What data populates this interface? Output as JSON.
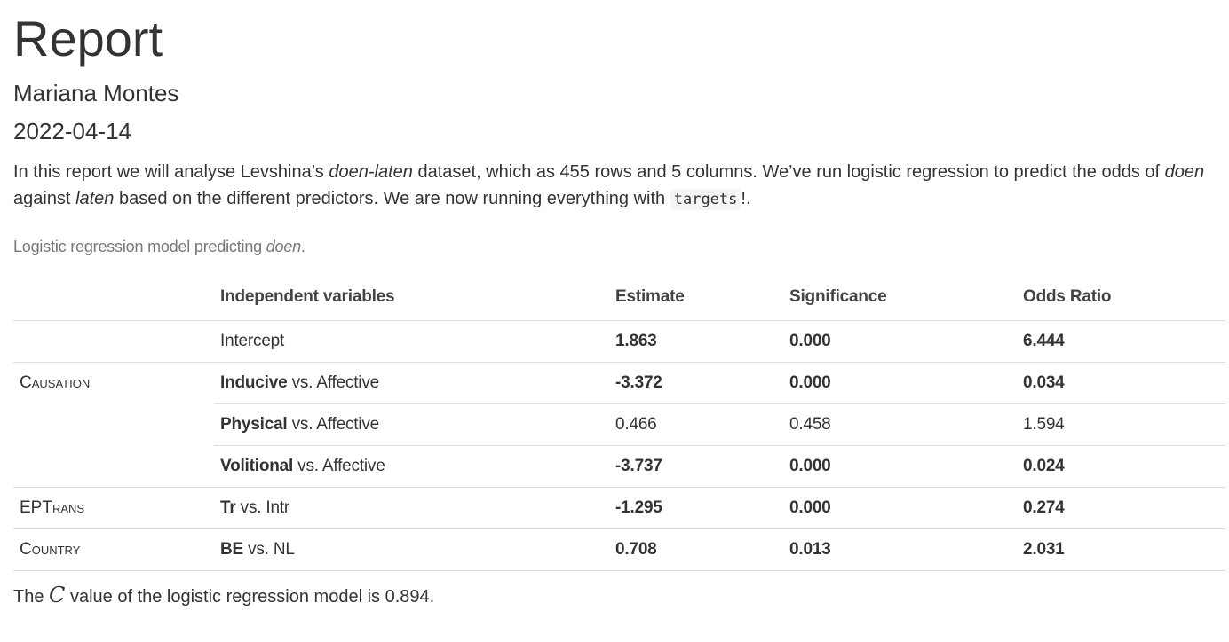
{
  "title": "Report",
  "author": "Mariana Montes",
  "date": "2022-04-14",
  "intro": {
    "p1": "In this report we will analyse Levshina’s ",
    "em1": "doen-laten",
    "p2": " dataset, which as 455 rows and 5 columns. We’ve run logistic regression to predict the odds of ",
    "em2": "doen",
    "p3": " against ",
    "em3": "laten",
    "p4": " based on the different predictors. We are now running everything with ",
    "code": "targets",
    "p5": "!."
  },
  "caption": {
    "text": "Logistic regression model predicting ",
    "em": "doen",
    "end": "."
  },
  "table": {
    "headers": [
      "",
      "Independent variables",
      "Estimate",
      "Significance",
      "Odds Ratio"
    ],
    "rows": [
      {
        "group": "",
        "var_bold": "",
        "var_rest": "Intercept",
        "estimate": "1.863",
        "significance": "0.000",
        "odds": "6.444",
        "bold_values": true
      },
      {
        "group": "Causation",
        "var_bold": "Inducive",
        "var_rest": " vs. Affective",
        "estimate": "-3.372",
        "significance": "0.000",
        "odds": "0.034",
        "bold_values": true
      },
      {
        "group": "",
        "var_bold": "Physical",
        "var_rest": " vs. Affective",
        "estimate": "0.466",
        "significance": "0.458",
        "odds": "1.594",
        "bold_values": false
      },
      {
        "group": "",
        "var_bold": "Volitional",
        "var_rest": " vs. Affective",
        "estimate": "-3.737",
        "significance": "0.000",
        "odds": "0.024",
        "bold_values": true
      },
      {
        "group": "EPTrans",
        "var_bold": "Tr",
        "var_rest": " vs. Intr",
        "estimate": "-1.295",
        "significance": "0.000",
        "odds": "0.274",
        "bold_values": true
      },
      {
        "group": "Country",
        "var_bold": "BE",
        "var_rest": " vs. NL",
        "estimate": "0.708",
        "significance": "0.013",
        "odds": "2.031",
        "bold_values": true
      }
    ]
  },
  "outro": {
    "p1": "The ",
    "math": "C",
    "p2": " value of the logistic regression model is 0.894."
  }
}
